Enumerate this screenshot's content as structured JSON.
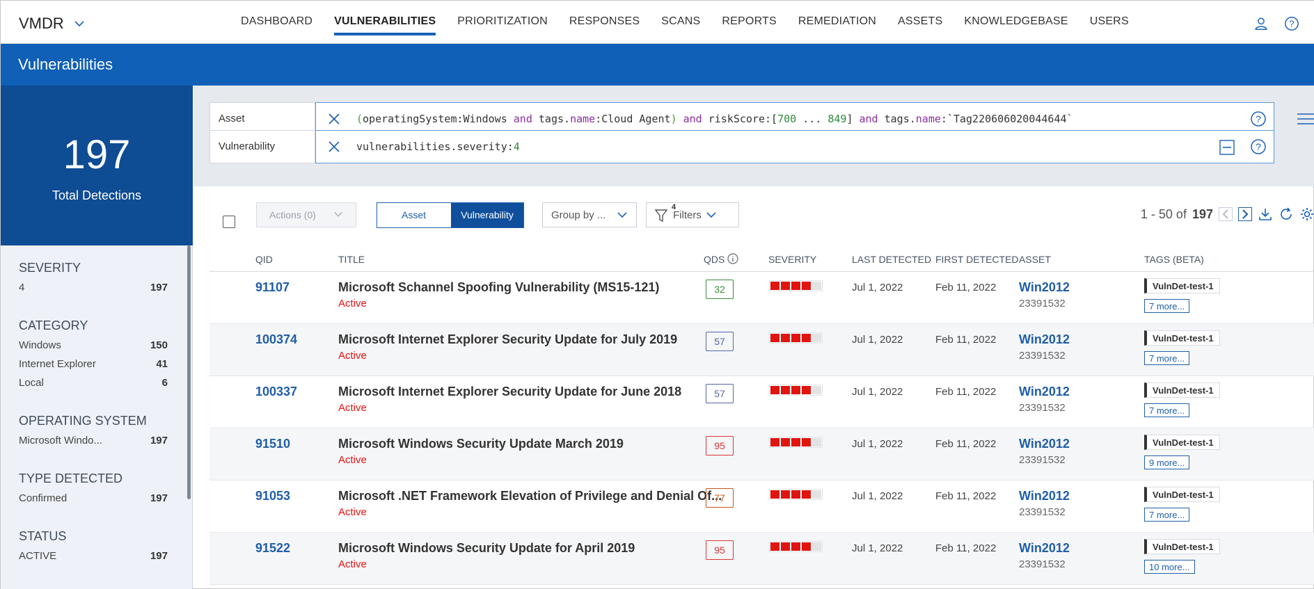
{
  "app": {
    "name": "VMDR"
  },
  "nav": {
    "items": [
      {
        "label": "DASHBOARD",
        "active": false
      },
      {
        "label": "VULNERABILITIES",
        "active": true
      },
      {
        "label": "PRIORITIZATION",
        "active": false
      },
      {
        "label": "RESPONSES",
        "active": false
      },
      {
        "label": "SCANS",
        "active": false
      },
      {
        "label": "REPORTS",
        "active": false
      },
      {
        "label": "REMEDIATION",
        "active": false
      },
      {
        "label": "ASSETS",
        "active": false
      },
      {
        "label": "KNOWLEDGEBASE",
        "active": false
      },
      {
        "label": "USERS",
        "active": false
      }
    ]
  },
  "page": {
    "title": "Vulnerabilities"
  },
  "summary": {
    "total": "197",
    "total_label": "Total Detections"
  },
  "facets": [
    {
      "title": "SEVERITY",
      "rows": [
        {
          "label": "4",
          "count": "197"
        }
      ]
    },
    {
      "title": "CATEGORY",
      "rows": [
        {
          "label": "Windows",
          "count": "150"
        },
        {
          "label": "Internet Explorer",
          "count": "41"
        },
        {
          "label": "Local",
          "count": "6"
        }
      ]
    },
    {
      "title": "OPERATING SYSTEM",
      "rows": [
        {
          "label": "Microsoft Windo...",
          "count": "197"
        }
      ]
    },
    {
      "title": "TYPE DETECTED",
      "rows": [
        {
          "label": "Confirmed",
          "count": "197"
        }
      ]
    },
    {
      "title": "STATUS",
      "rows": [
        {
          "label": "ACTIVE",
          "count": "197"
        }
      ]
    }
  ],
  "query": {
    "asset_label": "Asset",
    "asset_parts": {
      "p1": "(",
      "p2": "operatingSystem:Windows ",
      "p3": "and",
      "p4": " tags.",
      "p5": "name",
      "p6": ":Cloud Agent",
      "p7": ")",
      "p8": " ",
      "p9": "and",
      "p10": " riskScore:[",
      "p11": "700",
      "p12": " ... ",
      "p13": "849",
      "p14": "] ",
      "p15": "and",
      "p16": " tags.",
      "p17": "name",
      "p18": ":`Tag220606020044644`"
    },
    "vuln_label": "Vulnerability",
    "vuln_parts": {
      "p1": "vulnerabilities.severity:",
      "p2": "4"
    }
  },
  "toolbar": {
    "actions_label": "Actions (0)",
    "toggle_asset": "Asset",
    "toggle_vuln": "Vulnerability",
    "groupby_label": "Group by ...",
    "filters_label": "Filters",
    "filters_count": "4",
    "paging_range": "1 - 50 of",
    "paging_total": "197"
  },
  "table": {
    "headers": {
      "qid": "QID",
      "title": "TITLE",
      "qds": "QDS",
      "severity": "SEVERITY",
      "last": "LAST DETECTED",
      "first": "FIRST DETECTED",
      "asset": "ASSET",
      "tags": "TAGS (BETA)"
    },
    "rows": [
      {
        "qid": "91107",
        "title": "Microsoft Schannel Spoofing Vulnerability (MS15-121)",
        "status": "Active",
        "qds": "32",
        "severity": 4,
        "last": "Jul 1, 2022",
        "first": "Feb 11, 2022",
        "asset": "Win2012",
        "asset_id": "23391532",
        "tag": "VulnDet-test-1",
        "more": "7 more..."
      },
      {
        "qid": "100374",
        "title": "Microsoft Internet Explorer Security Update for July 2019",
        "status": "Active",
        "qds": "57",
        "severity": 4,
        "last": "Jul 1, 2022",
        "first": "Feb 11, 2022",
        "asset": "Win2012",
        "asset_id": "23391532",
        "tag": "VulnDet-test-1",
        "more": "7 more..."
      },
      {
        "qid": "100337",
        "title": "Microsoft Internet Explorer Security Update for June 2018",
        "status": "Active",
        "qds": "57",
        "severity": 4,
        "last": "Jul 1, 2022",
        "first": "Feb 11, 2022",
        "asset": "Win2012",
        "asset_id": "23391532",
        "tag": "VulnDet-test-1",
        "more": "7 more..."
      },
      {
        "qid": "91510",
        "title": "Microsoft Windows Security Update March 2019",
        "status": "Active",
        "qds": "95",
        "severity": 4,
        "last": "Jul 1, 2022",
        "first": "Feb 11, 2022",
        "asset": "Win2012",
        "asset_id": "23391532",
        "tag": "VulnDet-test-1",
        "more": "9 more..."
      },
      {
        "qid": "91053",
        "title": "Microsoft .NET Framework Elevation of Privilege and Denial Of...",
        "status": "Active",
        "qds": "77",
        "severity": 4,
        "last": "Jul 1, 2022",
        "first": "Feb 11, 2022",
        "asset": "Win2012",
        "asset_id": "23391532",
        "tag": "VulnDet-test-1",
        "more": "7 more..."
      },
      {
        "qid": "91522",
        "title": "Microsoft Windows Security Update for April 2019",
        "status": "Active",
        "qds": "95",
        "severity": 4,
        "last": "Jul 1, 2022",
        "first": "Feb 11, 2022",
        "asset": "Win2012",
        "asset_id": "23391532",
        "tag": "VulnDet-test-1",
        "more": "10 more..."
      }
    ]
  },
  "colors": {
    "brand_blue": "#0f60b6",
    "panel_blue": "#0e4c94",
    "link_blue": "#1f5ea8",
    "severity_red": "#e0150f",
    "active_red": "#ee1111"
  }
}
